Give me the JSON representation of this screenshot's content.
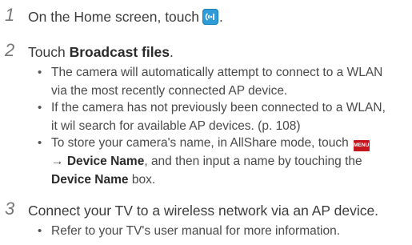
{
  "steps": [
    {
      "number": "1",
      "text_before": "On the Home screen, touch",
      "icon": "allshare-app-icon",
      "text_after": "."
    },
    {
      "number": "2",
      "text_before": "Touch ",
      "bold": "Broadcast files",
      "text_after": ".",
      "bullets": [
        {
          "lines": [
            "The camera will automatically attempt to connect to a WLAN",
            "via the most recently connected AP device."
          ]
        },
        {
          "lines": [
            "If the camera has not previously been connected to a WLAN,",
            "it wil search for available AP devices. (p. 108)"
          ]
        },
        {
          "line1_text": "To store your camera's name, in AllShare mode, touch",
          "menu_icon_label": "MENU",
          "line2_arrow": "→ ",
          "line2_bold": "Device Name",
          "line2_rest": ", and then input a name by touching the",
          "line3_bold": "Device Name",
          "line3_rest": " box."
        }
      ]
    },
    {
      "number": "3",
      "text": "Connect your TV to a wireless network via an AP device.",
      "bullets": [
        {
          "lines": [
            "Refer to your TV's user manual for more information."
          ]
        }
      ]
    }
  ],
  "colors": {
    "step_number": "#777777",
    "text": "#3c3c3c",
    "allshare_icon": "#2f9bd8",
    "menu_icon": "#c5161d"
  }
}
